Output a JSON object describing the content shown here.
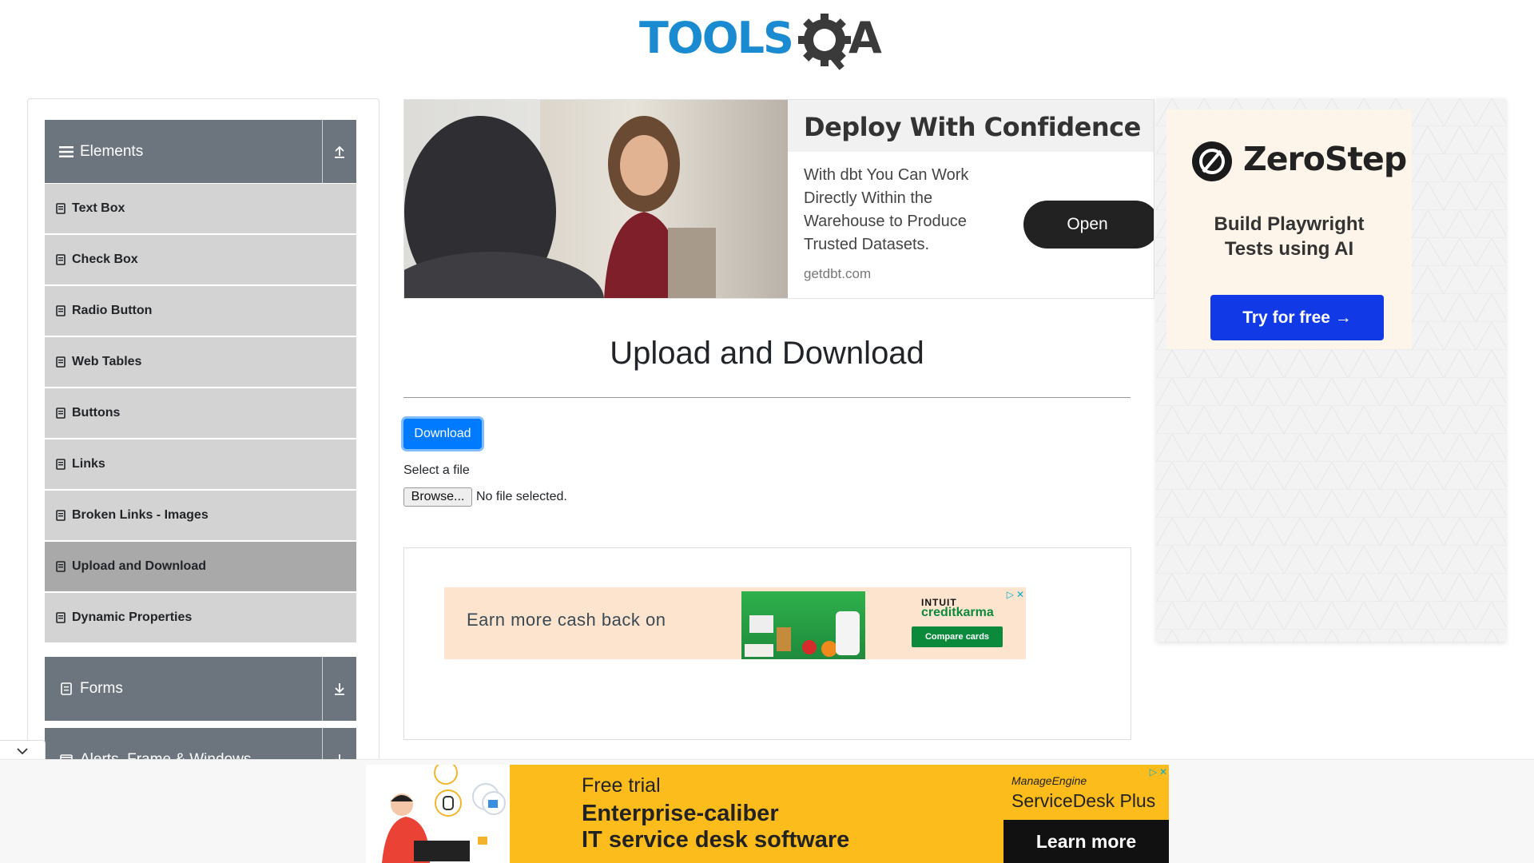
{
  "header": {
    "logo_text": "TOOLSQA"
  },
  "sidebar": {
    "elements_group": {
      "label": "Elements"
    },
    "items": [
      {
        "label": "Text Box",
        "active": false
      },
      {
        "label": "Check Box",
        "active": false
      },
      {
        "label": "Radio Button",
        "active": false
      },
      {
        "label": "Web Tables",
        "active": false
      },
      {
        "label": "Buttons",
        "active": false
      },
      {
        "label": "Links",
        "active": false
      },
      {
        "label": "Broken Links - Images",
        "active": false
      },
      {
        "label": "Upload and Download",
        "active": true
      },
      {
        "label": "Dynamic Properties",
        "active": false
      }
    ],
    "forms_group": {
      "label": "Forms"
    },
    "alerts_group": {
      "label": "Alerts, Frame & Windows"
    }
  },
  "top_ad": {
    "title": "Deploy With Confidence",
    "body": "With dbt You Can Work Directly Within the Warehouse to Produce Trusted Datasets.",
    "domain": "getdbt.com",
    "button": "Open"
  },
  "main": {
    "title": "Upload and Download",
    "download_button": "Download",
    "select_label": "Select a file",
    "browse_button": "Browse...",
    "file_status": "No file selected."
  },
  "inner_ad": {
    "text": "Earn more cash back on",
    "brand_line1": "INTUIT",
    "brand_line2": "creditkarma",
    "button": "Compare cards"
  },
  "right_ad": {
    "brand": "ZeroStep",
    "tagline_1": "Build Playwright",
    "tagline_2": "Tests using AI",
    "button": "Try for free →"
  },
  "bottom_ad": {
    "line1": "Free trial",
    "line2": "Enterprise-caliber",
    "line3": "IT service desk software",
    "brand_small": "ManageEngine",
    "brand_big": "ServiceDesk Plus",
    "button": "Learn more"
  },
  "colors": {
    "sidebar_group": "#6c757d",
    "menu_item": "#d3d3d3",
    "menu_active": "#a9a9a9",
    "primary": "#007bff",
    "logo_blue": "#1a8ad1"
  }
}
